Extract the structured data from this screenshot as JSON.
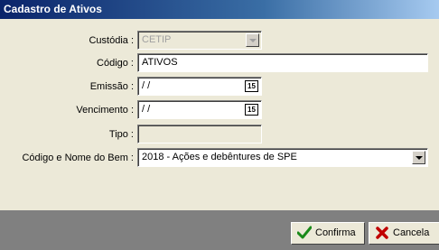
{
  "window": {
    "title": "Cadastro de Ativos"
  },
  "form": {
    "custodia": {
      "label": "Custódia :",
      "value": "CETIP"
    },
    "codigo": {
      "label": "Código :",
      "value": "ATIVOS"
    },
    "emissao": {
      "label": "Emissão :",
      "value": " /  /",
      "cal_icon": "15"
    },
    "vencimento": {
      "label": "Vencimento :",
      "value": " /  /",
      "cal_icon": "15"
    },
    "tipo": {
      "label": "Tipo :",
      "value": ""
    },
    "codigo_nome_bem": {
      "label": "Código e Nome do Bem :",
      "value": "2018 - Ações e debêntures de SPE"
    }
  },
  "buttons": {
    "confirma": "Confirma",
    "cancela": "Cancela"
  },
  "colors": {
    "confirm_icon": "#1a8a1a",
    "cancel_icon": "#c00000"
  }
}
